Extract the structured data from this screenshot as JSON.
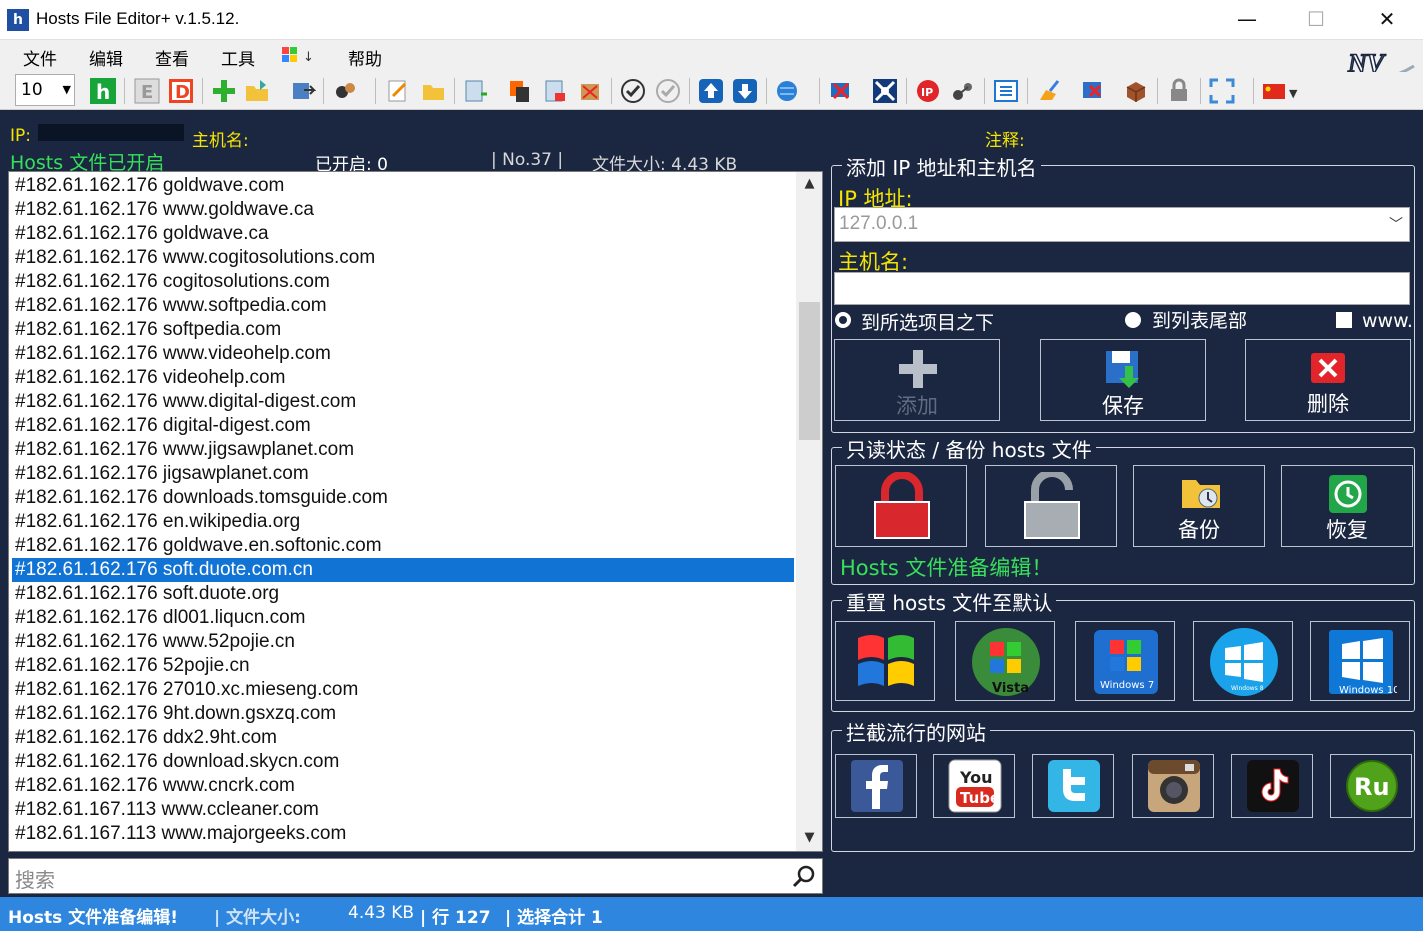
{
  "window": {
    "title": "Hosts File Editor+ v.1.5.12.",
    "minimize": "—",
    "maximize": "☐",
    "close": "✕"
  },
  "menu": {
    "file": "文件",
    "edit": "编辑",
    "view": "查看",
    "tools": "工具",
    "help": "帮助"
  },
  "toolbar": {
    "zoom_value": "10"
  },
  "header": {
    "ip_label": "IP:",
    "hostname_label": "主机名:",
    "comment_label": "注释:",
    "status": "Hosts 文件已开启",
    "enabled": "已开启:  0",
    "no": "| No.37 |",
    "file_size": "文件大小:  4.43 KB"
  },
  "hosts": [
    "#182.61.162.176 goldwave.com",
    "#182.61.162.176 www.goldwave.ca",
    "#182.61.162.176 goldwave.ca",
    "#182.61.162.176 www.cogitosolutions.com",
    "#182.61.162.176 cogitosolutions.com",
    "#182.61.162.176 www.softpedia.com",
    "#182.61.162.176 softpedia.com",
    "#182.61.162.176 www.videohelp.com",
    "#182.61.162.176 videohelp.com",
    "#182.61.162.176 www.digital-digest.com",
    "#182.61.162.176 digital-digest.com",
    "#182.61.162.176 www.jigsawplanet.com",
    "#182.61.162.176 jigsawplanet.com",
    "#182.61.162.176 downloads.tomsguide.com",
    "#182.61.162.176 en.wikipedia.org",
    "#182.61.162.176 goldwave.en.softonic.com",
    "#182.61.162.176 soft.duote.com.cn",
    "#182.61.162.176 soft.duote.org",
    "#182.61.162.176 dl001.liqucn.com",
    "#182.61.162.176 www.52pojie.cn",
    "#182.61.162.176 52pojie.cn",
    "#182.61.162.176 27010.xc.mieseng.com",
    "#182.61.162.176 9ht.down.gsxzq.com",
    "#182.61.162.176 ddx2.9ht.com",
    "#182.61.162.176 download.skycn.com",
    "#182.61.162.176 www.cncrk.com",
    "#182.61.167.113 www.ccleaner.com",
    "#182.61.167.113 www.majorgeeks.com"
  ],
  "selected_index": 16,
  "search": {
    "placeholder": "搜索"
  },
  "add_panel": {
    "title": "添加 IP 地址和主机名",
    "ip_label": "IP 地址:",
    "ip_value": "127.0.0.1",
    "hostname_label": "主机名:",
    "opt_below": "到所选项目之下",
    "opt_end": "到列表尾部",
    "opt_www": "www.",
    "add": "添加",
    "save": "保存",
    "delete": "删除"
  },
  "readonly_panel": {
    "title": "只读状态 / 备份 hosts 文件",
    "backup": "备份",
    "restore": "恢复",
    "message": "Hosts 文件准备编辑！"
  },
  "reset_panel": {
    "title": "重置 hosts 文件至默认",
    "vista": "Vista",
    "win7": "Windows 7",
    "win10": "Windows 10",
    "win8": "Windows 8"
  },
  "block_panel": {
    "title": "拦截流行的网站",
    "youtube_top": "You",
    "youtube_bottom": "Tube",
    "ru": "Ru"
  },
  "statusbar": {
    "message": "Hosts 文件准备编辑!",
    "size_label": "|   文件大小:",
    "size_value": "4.43 KB",
    "rows": "|  行 127",
    "selected": "|  选择合计 1"
  },
  "colors": {
    "bg": "#1b2740",
    "accent": "#2f86de",
    "yellow": "#f5e400",
    "green": "#36e05a",
    "selection": "#1173d4"
  }
}
